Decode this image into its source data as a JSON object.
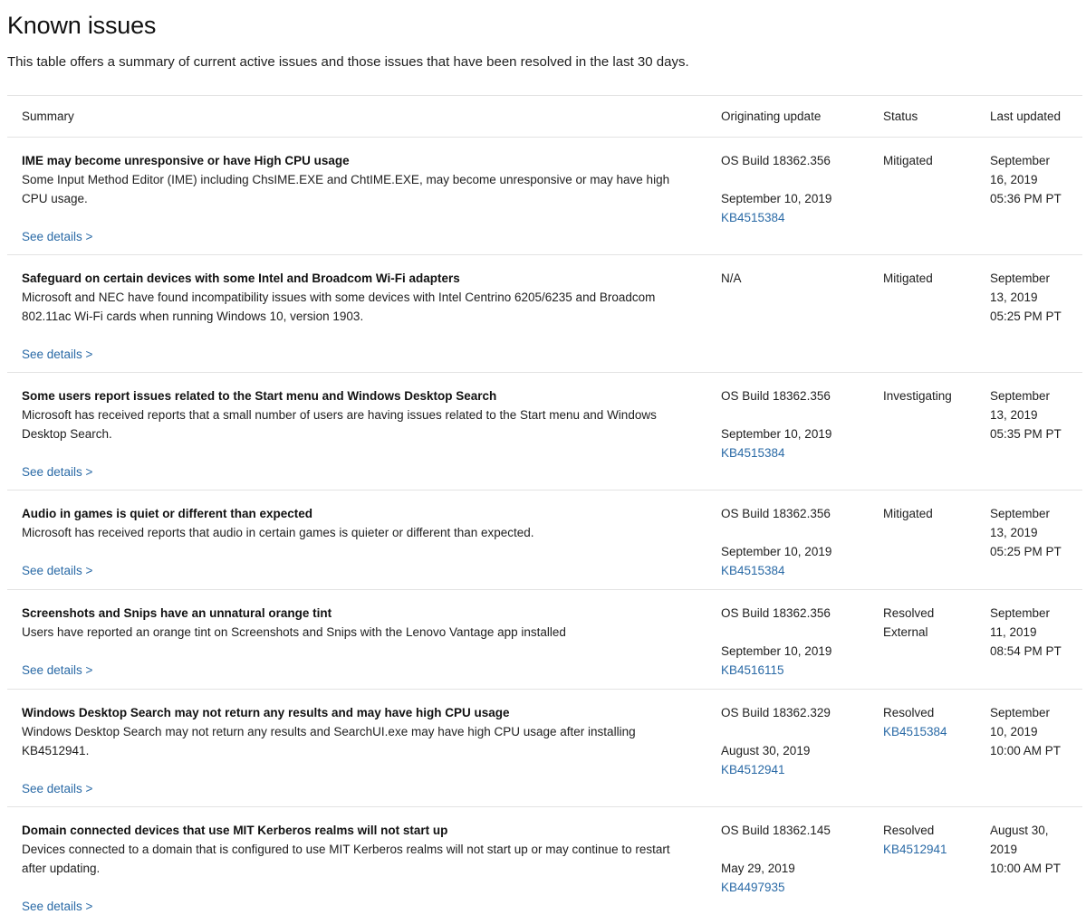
{
  "page": {
    "title": "Known issues",
    "intro": "This table offers a summary of current active issues and those issues that have been resolved in the last 30 days."
  },
  "colors": {
    "link": "#2a6aa6",
    "text": "#1e1e1e",
    "divider": "#e3e3e3"
  },
  "table": {
    "headers": {
      "summary": "Summary",
      "originating_update": "Originating update",
      "status": "Status",
      "last_updated": "Last updated"
    },
    "see_details_label": "See details >",
    "rows": [
      {
        "title": "IME may become unresponsive or have High CPU usage",
        "description": "Some Input Method Editor (IME) including ChsIME.EXE and ChtIME.EXE, may become unresponsive or may have high CPU usage.",
        "origin_build": "OS Build 18362.356",
        "origin_date": "September 10, 2019",
        "origin_kb": "KB4515384",
        "status": "Mitigated",
        "status_kb": "",
        "updated_line1": "September",
        "updated_line2": "16, 2019",
        "updated_line3": "05:36 PM PT"
      },
      {
        "title": "Safeguard on certain devices with some Intel and Broadcom Wi-Fi adapters",
        "description": "Microsoft and NEC have found incompatibility issues with some devices with Intel Centrino 6205/6235 and Broadcom 802.11ac Wi-Fi cards when running Windows 10, version 1903.",
        "origin_build": "N/A",
        "origin_date": "",
        "origin_kb": "",
        "status": "Mitigated",
        "status_kb": "",
        "updated_line1": "September",
        "updated_line2": "13, 2019",
        "updated_line3": "05:25 PM PT"
      },
      {
        "title": "Some users report issues related to the Start menu and Windows Desktop Search",
        "description": "Microsoft has received reports that a small number of users are having issues related to the Start menu and Windows Desktop Search.",
        "origin_build": "OS Build 18362.356",
        "origin_date": "September 10, 2019",
        "origin_kb": "KB4515384",
        "status": "Investigating",
        "status_kb": "",
        "updated_line1": "September",
        "updated_line2": "13, 2019",
        "updated_line3": "05:35 PM PT"
      },
      {
        "title": "Audio in games is quiet or different than expected",
        "description": "Microsoft has received reports that audio in certain games is quieter or different than expected.",
        "origin_build": "OS Build 18362.356",
        "origin_date": "September 10, 2019",
        "origin_kb": "KB4515384",
        "status": "Mitigated",
        "status_kb": "",
        "updated_line1": "September",
        "updated_line2": "13, 2019",
        "updated_line3": "05:25 PM PT"
      },
      {
        "title": "Screenshots and Snips have an unnatural orange tint",
        "description": "Users have reported an orange tint on Screenshots and Snips with the Lenovo Vantage app installed",
        "origin_build": "OS Build 18362.356",
        "origin_date": "September 10, 2019",
        "origin_kb": "KB4516115",
        "status": "Resolved External",
        "status_kb": "",
        "updated_line1": "September",
        "updated_line2": "11, 2019",
        "updated_line3": "08:54 PM PT"
      },
      {
        "title": "Windows Desktop Search may not return any results and may have high CPU usage",
        "description": "Windows Desktop Search may not return any results and SearchUI.exe may have high CPU usage after installing KB4512941.",
        "origin_build": "OS Build 18362.329",
        "origin_date": "August 30, 2019",
        "origin_kb": "KB4512941",
        "status": "Resolved",
        "status_kb": "KB4515384",
        "updated_line1": "September",
        "updated_line2": "10, 2019",
        "updated_line3": "10:00 AM PT"
      },
      {
        "title": "Domain connected devices that use MIT Kerberos realms will not start up",
        "description": "Devices connected to a domain that is configured to use MIT Kerberos realms will not start up or may continue to restart after updating.",
        "origin_build": "OS Build 18362.145",
        "origin_date": "May 29, 2019",
        "origin_kb": "KB4497935",
        "status": "Resolved",
        "status_kb": "KB4512941",
        "updated_line1": "August 30,",
        "updated_line2": "2019",
        "updated_line3": "10:00 AM PT"
      }
    ]
  }
}
